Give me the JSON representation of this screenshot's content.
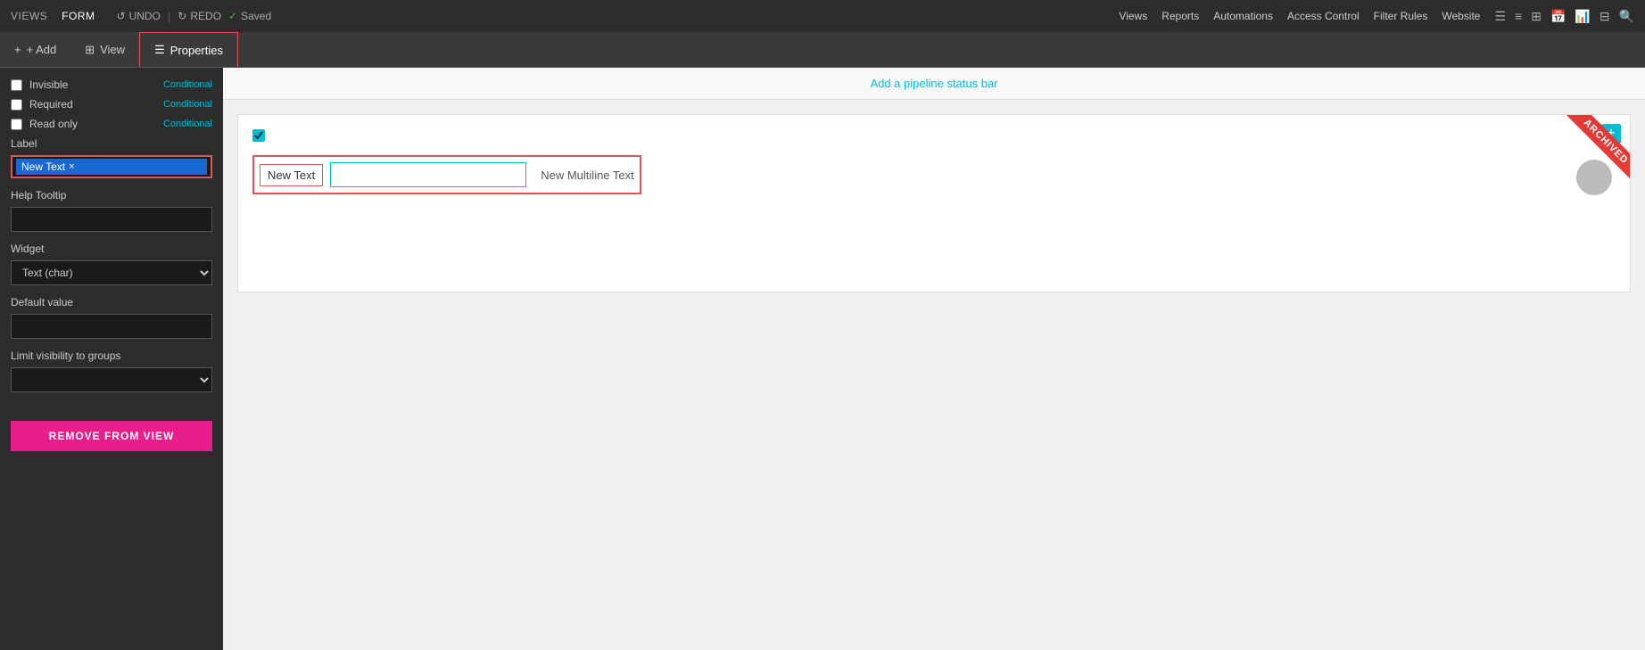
{
  "top_nav": {
    "views_label": "VIEWS",
    "form_label": "FORM",
    "undo_label": "UNDO",
    "redo_label": "REDO",
    "saved_label": "Saved",
    "right_items": [
      "Views",
      "Reports",
      "Automations",
      "Access Control",
      "Filter Rules",
      "Website"
    ]
  },
  "toolbar": {
    "add_label": "+ Add",
    "view_label": "View",
    "properties_label": "Properties"
  },
  "sidebar": {
    "invisible_label": "Invisible",
    "required_label": "Required",
    "read_only_label": "Read only",
    "conditional_label": "Conditional",
    "label_section": "Label",
    "label_value": "New Text",
    "label_x": "×",
    "help_tooltip_label": "Help Tooltip",
    "widget_label": "Widget",
    "widget_value": "Text (char)",
    "default_value_label": "Default value",
    "visibility_label": "Limit visibility to groups",
    "remove_btn_label": "REMOVE FROM VIEW"
  },
  "pipeline_bar": {
    "text": "Add a pipeline status bar"
  },
  "form": {
    "add_plus": "+",
    "archived_text": "ARCHIVED",
    "checkbox_checked": true,
    "field_label": "New Text",
    "field_multiline": "New Multiline Text"
  }
}
